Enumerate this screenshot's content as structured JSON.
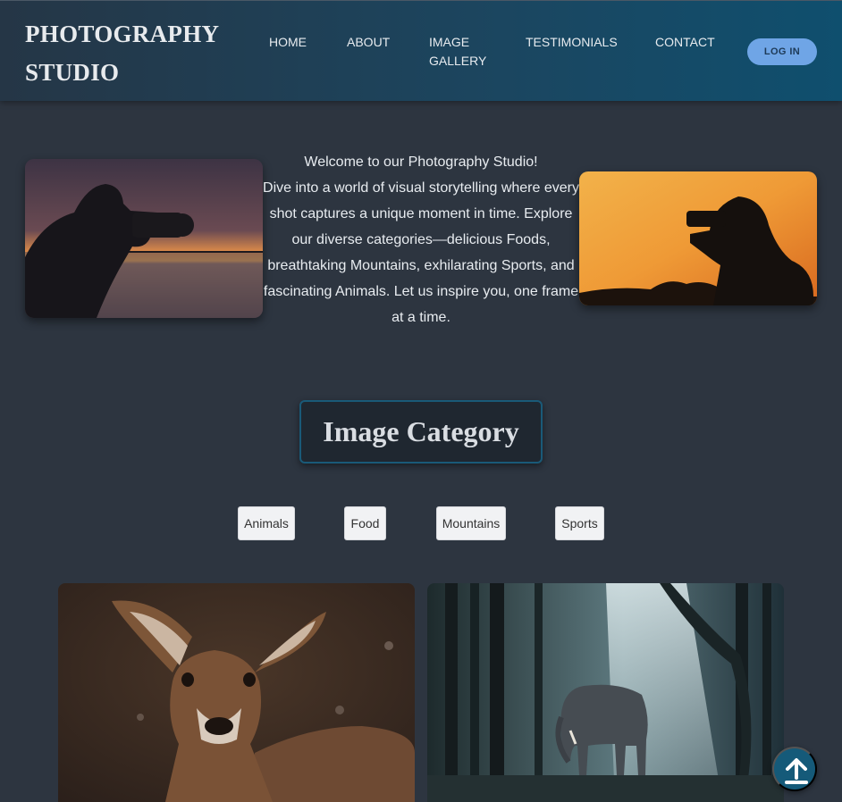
{
  "header": {
    "logo_line1": "PHOTOGRAPHY",
    "logo_line2": "STUDIO",
    "nav": [
      "HOME",
      "ABOUT",
      "IMAGE",
      "GALLERY",
      "TESTIMONIALS",
      "CONTACT"
    ],
    "login_label": "LOG IN"
  },
  "hero": {
    "welcome_title": "Welcome to our Photography Studio!",
    "welcome_body": "Dive into a world of visual storytelling where every shot captures a unique moment in time. Explore our diverse categories—delicious Foods, breathtaking Mountains, exhilarating Sports, and fascinating Animals. Let us inspire you, one frame at a time."
  },
  "category": {
    "title": "Image Category",
    "filters": [
      "Animals",
      "Food",
      "Mountains",
      "Sports"
    ]
  },
  "colors": {
    "background": "#2d3540",
    "header_start": "#253646",
    "header_end": "#0f4f6e",
    "login_button": "#6fa5e6",
    "accent": "#155a79"
  },
  "icons": {
    "scroll_top": "arrow-up-icon"
  }
}
